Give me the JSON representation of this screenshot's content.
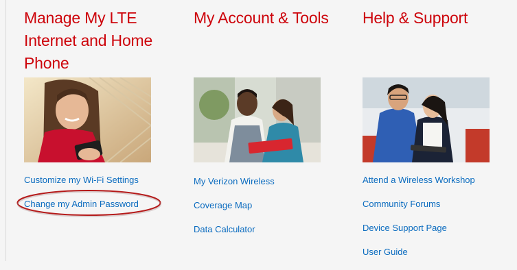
{
  "columns": [
    {
      "heading_lines": [
        "Manage My LTE",
        "Internet and Home",
        "Phone"
      ],
      "photo": "woman-in-hammock-with-phone-photo",
      "links": [
        "Customize my Wi-Fi Settings",
        "Change my Admin Password"
      ]
    },
    {
      "heading_lines": [
        "My Account & Tools"
      ],
      "photo": "man-and-woman-with-tablet-photo",
      "links": [
        "My Verizon Wireless",
        "Coverage Map",
        "Data Calculator"
      ]
    },
    {
      "heading_lines": [
        "Help & Support"
      ],
      "photo": "couple-using-tablet-photo",
      "links": [
        "Attend a Wireless Workshop",
        "Community Forums",
        "Device Support Page",
        "User Guide"
      ]
    }
  ],
  "colors": {
    "heading_red": "#cd040b",
    "link_blue": "#0a6bbf",
    "highlight_ellipse": "#b51a1a"
  }
}
